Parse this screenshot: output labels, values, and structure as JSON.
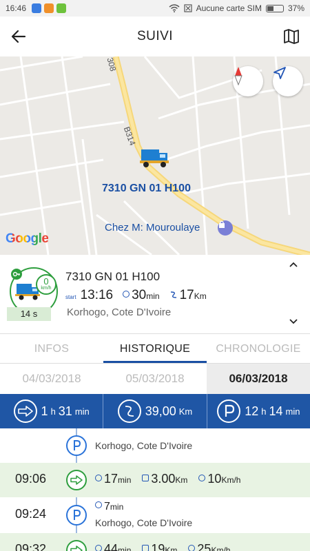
{
  "status_bar": {
    "time": "16:46",
    "carrier": "Aucune carte SIM",
    "battery": "37%"
  },
  "app_bar": {
    "title": "SUIVI"
  },
  "map": {
    "road_1": "308",
    "road_2": "B314",
    "vehicle_label": "7310 GN 01 H100",
    "poi_label": "Chez M: Mouroulaye",
    "attribution": "Google"
  },
  "vehicle_card": {
    "plate": "7310 GN 01 H100",
    "speed_value": "0",
    "speed_unit": "km/h",
    "stop_duration": "14 s",
    "start_label": "start",
    "start_time": "13:16",
    "duration_value": "30",
    "duration_unit": "min",
    "distance_value": "17",
    "distance_unit": "Km",
    "location": "Korhogo, Cote D'Ivoire"
  },
  "tabs": [
    {
      "label": "INFOS",
      "active": false
    },
    {
      "label": "HISTORIQUE",
      "active": true
    },
    {
      "label": "CHRONOLOGIE",
      "active": false
    }
  ],
  "dates": [
    {
      "label": "04/03/2018",
      "selected": false
    },
    {
      "label": "05/03/2018",
      "selected": false
    },
    {
      "label": "06/03/2018",
      "selected": true
    }
  ],
  "summary": {
    "driving_hours": "1",
    "driving_hours_unit": "h",
    "driving_minutes": "31",
    "driving_minutes_unit": "min",
    "distance_value": "39,00",
    "distance_unit": "Km",
    "parked_hours": "12",
    "parked_hours_unit": "h",
    "parked_minutes": "14",
    "parked_minutes_unit": "min"
  },
  "timeline": {
    "row0": {
      "location": "Korhogo, Cote D'Ivoire"
    },
    "row1": {
      "time": "09:06",
      "duration": "17",
      "duration_unit": "min",
      "distance": "3.00",
      "distance_unit": "Km",
      "speed": "10",
      "speed_unit": "Km/h"
    },
    "row2": {
      "time": "09:24",
      "duration": "7",
      "duration_unit": "min",
      "location": "Korhogo, Cote D'Ivoire"
    },
    "row3": {
      "time": "09:32",
      "duration": "44",
      "duration_unit": "min",
      "distance": "19",
      "distance_unit": "Km",
      "speed": "25",
      "speed_unit": "Km/h"
    }
  },
  "colors": {
    "primary_blue": "#1f56a5",
    "accent_green": "#2e9e3e",
    "parking_blue": "#2a73d9"
  }
}
